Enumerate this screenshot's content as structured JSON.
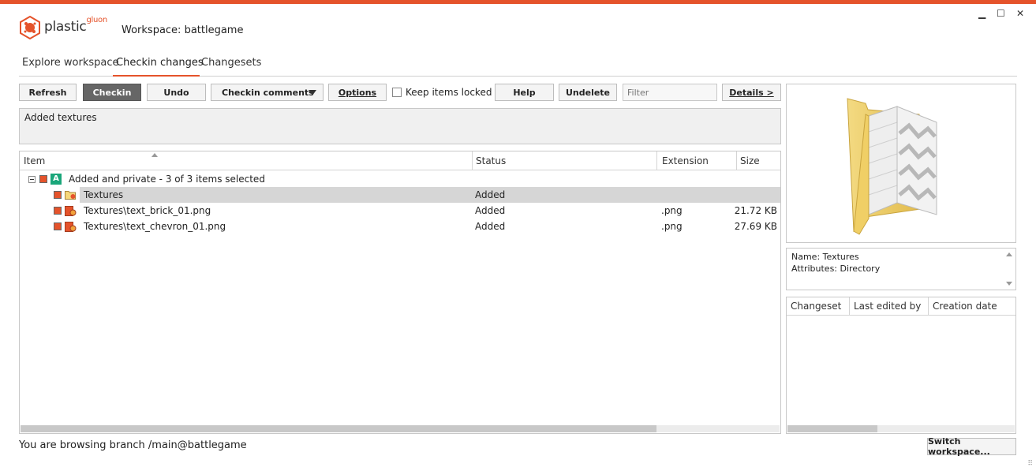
{
  "app": {
    "brand": "plastic",
    "brand_sup": "gluon",
    "workspace_title": "Workspace: battlegame",
    "accent": "#e5532b"
  },
  "window": {
    "minimize": "▁",
    "maximize": "☐",
    "close": "✕"
  },
  "tabs": [
    {
      "label": "Explore workspace",
      "active": false
    },
    {
      "label": "Checkin changes",
      "active": true
    },
    {
      "label": "Changesets",
      "active": false
    }
  ],
  "toolbar": {
    "refresh": "Refresh",
    "checkin": "Checkin",
    "undo": "Undo",
    "checkin_comments": "Checkin comments",
    "options": "Options",
    "keep_locked": "Keep items locked",
    "keep_locked_checked": false,
    "help": "Help",
    "undelete": "Undelete",
    "filter_placeholder": "Filter",
    "details": "Details >"
  },
  "comment": "Added textures",
  "grid": {
    "columns": [
      "Item",
      "Status",
      "Extension",
      "Size"
    ],
    "group": {
      "badge": "A",
      "label": "Added and private - 3 of 3 items selected"
    },
    "rows": [
      {
        "item": "Textures",
        "status": "Added",
        "extension": "",
        "size": "",
        "type": "folder",
        "selected": true
      },
      {
        "item": "Textures\\text_brick_01.png",
        "status": "Added",
        "extension": ".png",
        "size": "21.72 KB",
        "type": "file",
        "selected": false
      },
      {
        "item": "Textures\\text_chevron_01.png",
        "status": "Added",
        "extension": ".png",
        "size": "27.69 KB",
        "type": "file",
        "selected": false
      }
    ]
  },
  "properties": {
    "name": "Name: Textures",
    "attributes": "Attributes: Directory"
  },
  "history": {
    "columns": [
      "Changeset",
      "Last edited by",
      "Creation date"
    ]
  },
  "status_bar": "You are browsing branch /main@battlegame",
  "switch_workspace": "Switch workspace..."
}
